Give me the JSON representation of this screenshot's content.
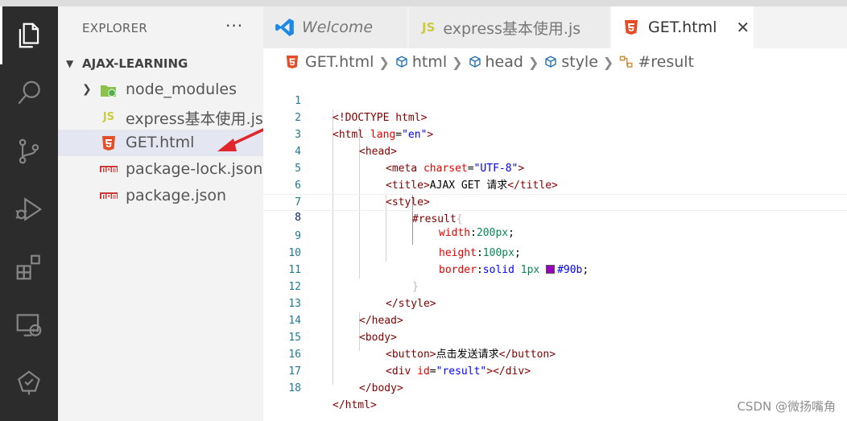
{
  "explorer": {
    "title": "EXPLORER",
    "more": "···",
    "root": "AJAX-LEARNING",
    "items": [
      {
        "label": "node_modules",
        "icon": "node-folder-icon"
      },
      {
        "label": "express基本使用.js",
        "icon": "js-file-icon",
        "badge": "JS"
      },
      {
        "label": "GET.html",
        "icon": "html5-file-icon",
        "selected": true
      },
      {
        "label": "package-lock.json",
        "icon": "npm-file-icon"
      },
      {
        "label": "package.json",
        "icon": "npm-file-icon"
      }
    ]
  },
  "tabs": [
    {
      "label": "Welcome",
      "icon": "vscode-logo-icon"
    },
    {
      "label": "express基本使用.js",
      "icon": "js-file-icon",
      "badge": "JS"
    },
    {
      "label": "GET.html",
      "icon": "html5-file-icon",
      "active": true,
      "close": "✕"
    }
  ],
  "breadcrumb": [
    "GET.html",
    "html",
    "head",
    "style",
    "#result"
  ],
  "editor": {
    "line_numbers": [
      "1",
      "2",
      "3",
      "4",
      "5",
      "6",
      "7",
      "8",
      "9",
      "10",
      "11",
      "12",
      "13",
      "14",
      "15",
      "16",
      "17",
      "18"
    ],
    "current_line": 8,
    "code": {
      "l1": "<!DOCTYPE html>",
      "l2_tag": "<html",
      "l2_attr": "lang",
      "l2_val": "\"en\"",
      "l3": "<head>",
      "l4_tag": "<meta",
      "l4_attr": "charset",
      "l4_val": "\"UTF-8\"",
      "l5_open": "<title>",
      "l5_text": "AJAX GET 请求",
      "l5_close": "</title>",
      "l6": "<style>",
      "l7_sel": "#result",
      "l7_brace": "{",
      "l8_prop": "width",
      "l8_val": "200px",
      "l9_prop": "height",
      "l9_val": "100px",
      "l10_prop": "border",
      "l10_val1": "solid",
      "l10_val2": "1px",
      "l10_val3": "#90b",
      "l11": "}",
      "l12": "</style>",
      "l13": "</head>",
      "l14": "<body>",
      "l15_open": "<button>",
      "l15_text": "点击发送请求",
      "l15_close": "</button>",
      "l16_tag": "<div",
      "l16_attr": "id",
      "l16_val": "\"result\"",
      "l16_close": "></div>",
      "l17": "</body>",
      "l18": "</html>"
    }
  },
  "watermark": "CSDN @微扬嘴角",
  "colors": {
    "activity_bar": "#2c2c2c",
    "sidebar": "#f3f3f3",
    "html_icon": "#e44d26",
    "js_icon": "#cbcb41",
    "npm_icon": "#cb3837",
    "swatch": "#9900bb",
    "arrow": "#e0252b"
  }
}
